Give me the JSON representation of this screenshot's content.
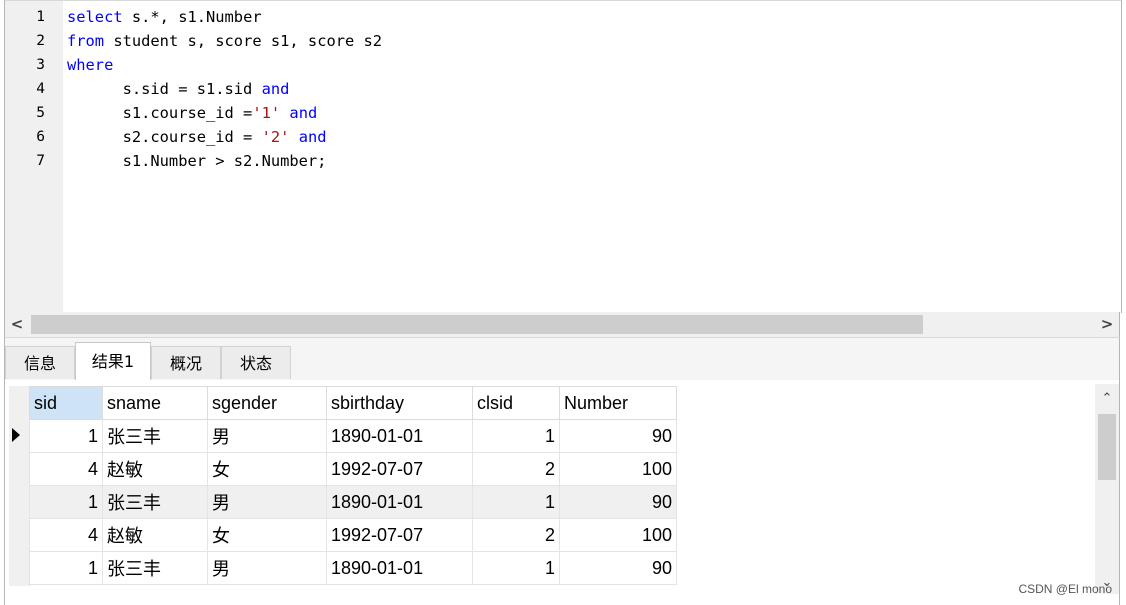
{
  "editor": {
    "lines": [
      {
        "num": "1",
        "segs": [
          {
            "t": "select",
            "c": "kw"
          },
          {
            "t": " s.*, s1.Number",
            "c": ""
          }
        ]
      },
      {
        "num": "2",
        "segs": [
          {
            "t": "from",
            "c": "kw"
          },
          {
            "t": " student s, score s1, score s2",
            "c": ""
          }
        ]
      },
      {
        "num": "3",
        "segs": [
          {
            "t": "where",
            "c": "kw"
          }
        ]
      },
      {
        "num": "4",
        "segs": [
          {
            "t": "      s.sid = s1.sid ",
            "c": ""
          },
          {
            "t": "and",
            "c": "kw"
          }
        ]
      },
      {
        "num": "5",
        "segs": [
          {
            "t": "      s1.course_id =",
            "c": ""
          },
          {
            "t": "'1'",
            "c": "str"
          },
          {
            "t": " ",
            "c": ""
          },
          {
            "t": "and",
            "c": "kw"
          }
        ]
      },
      {
        "num": "6",
        "segs": [
          {
            "t": "      s2.course_id = ",
            "c": ""
          },
          {
            "t": "'2'",
            "c": "str"
          },
          {
            "t": " ",
            "c": ""
          },
          {
            "t": "and",
            "c": "kw"
          }
        ]
      },
      {
        "num": "7",
        "segs": [
          {
            "t": "      s1.Number > s2.Number;",
            "c": ""
          }
        ]
      }
    ]
  },
  "hscroll": {
    "left_icon": "chevron-left-icon",
    "right_icon": "chevron-right-icon",
    "left_glyph": "<",
    "right_glyph": ">"
  },
  "tabs": [
    {
      "label": "信息",
      "active": false
    },
    {
      "label": "结果1",
      "active": true
    },
    {
      "label": "概况",
      "active": false
    },
    {
      "label": "状态",
      "active": false
    }
  ],
  "grid": {
    "columns": [
      "sid",
      "sname",
      "sgender",
      "sbirthday",
      "clsid",
      "Number"
    ],
    "rows": [
      {
        "sid": "1",
        "sname": "张三丰",
        "sgender": "男",
        "sbirthday": "1890-01-01",
        "clsid": "1",
        "Number": "90"
      },
      {
        "sid": "4",
        "sname": "赵敏",
        "sgender": "女",
        "sbirthday": "1992-07-07",
        "clsid": "2",
        "Number": "100"
      },
      {
        "sid": "1",
        "sname": "张三丰",
        "sgender": "男",
        "sbirthday": "1890-01-01",
        "clsid": "1",
        "Number": "90"
      },
      {
        "sid": "4",
        "sname": "赵敏",
        "sgender": "女",
        "sbirthday": "1992-07-07",
        "clsid": "2",
        "Number": "100"
      },
      {
        "sid": "1",
        "sname": "张三丰",
        "sgender": "男",
        "sbirthday": "1890-01-01",
        "clsid": "1",
        "Number": "90"
      }
    ],
    "current_row_index": 0,
    "highlighted_row_index": 2
  },
  "vscroll": {
    "up_glyph": "⌃",
    "down_glyph": "⌄"
  },
  "watermark": "CSDN @El mono",
  "colors": {
    "keyword": "#0000ff",
    "string": "#a31515",
    "header_selected": "#cfe3f6"
  }
}
